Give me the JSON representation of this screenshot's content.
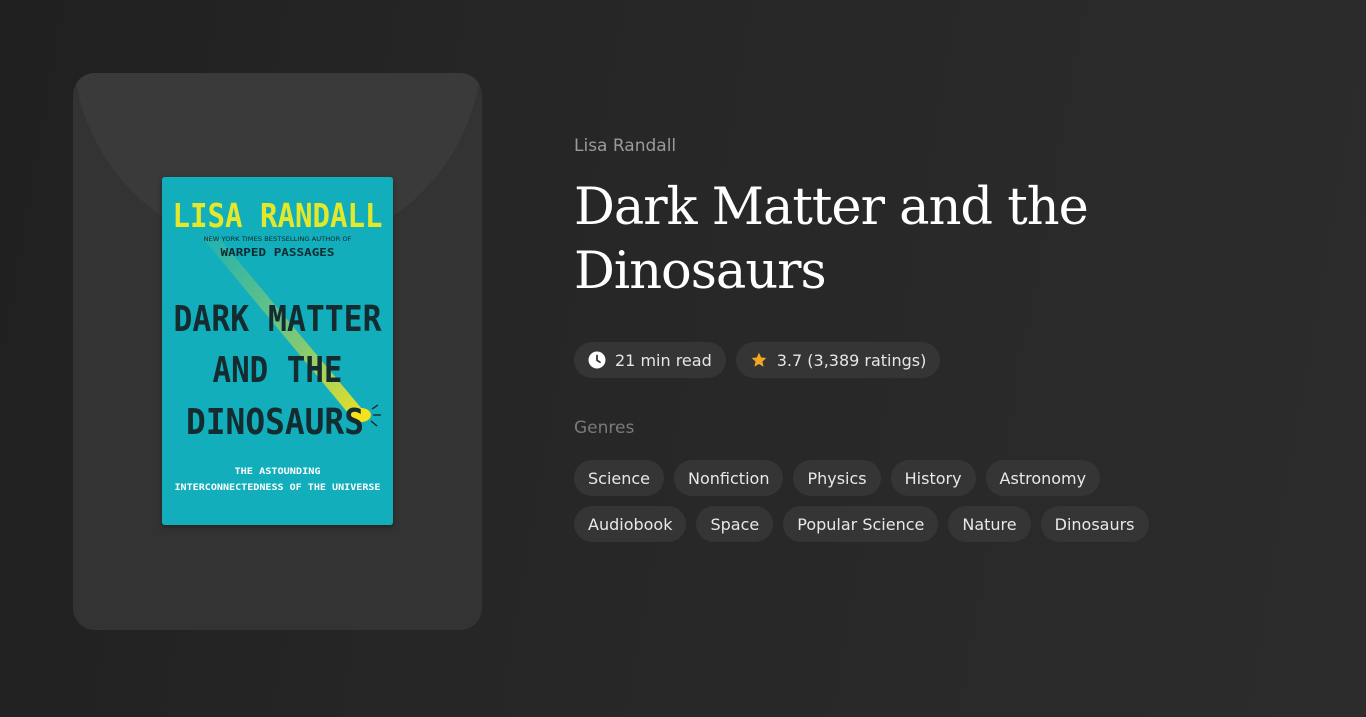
{
  "book": {
    "author": "Lisa Randall",
    "title": "Dark Matter and the Dinosaurs",
    "read_time": "21 min read",
    "rating": "3.7 (3,389 ratings)"
  },
  "cover": {
    "author": "LISA RANDALL",
    "tagline": "NEW YORK TIMES BESTSELLING AUTHOR OF",
    "previous_book": "WARPED PASSAGES",
    "title_line1": "DARK MATTER",
    "title_line2": "AND THE",
    "title_line3": "DINOSAURS",
    "subtitle_line1": "THE ASTOUNDING",
    "subtitle_line2": "INTERCONNECTEDNESS OF THE UNIVERSE",
    "background_color": "#12aebb",
    "author_color": "#e3e82a",
    "comet_color": "#f2e52a"
  },
  "genres": {
    "label": "Genres",
    "items": [
      "Science",
      "Nonfiction",
      "Physics",
      "History",
      "Astronomy",
      "Audiobook",
      "Space",
      "Popular Science",
      "Nature",
      "Dinosaurs"
    ]
  },
  "icons": {
    "read_time": "clock-icon",
    "rating": "star-icon"
  },
  "colors": {
    "star": "#f5a623",
    "pill_background": "#353535"
  }
}
